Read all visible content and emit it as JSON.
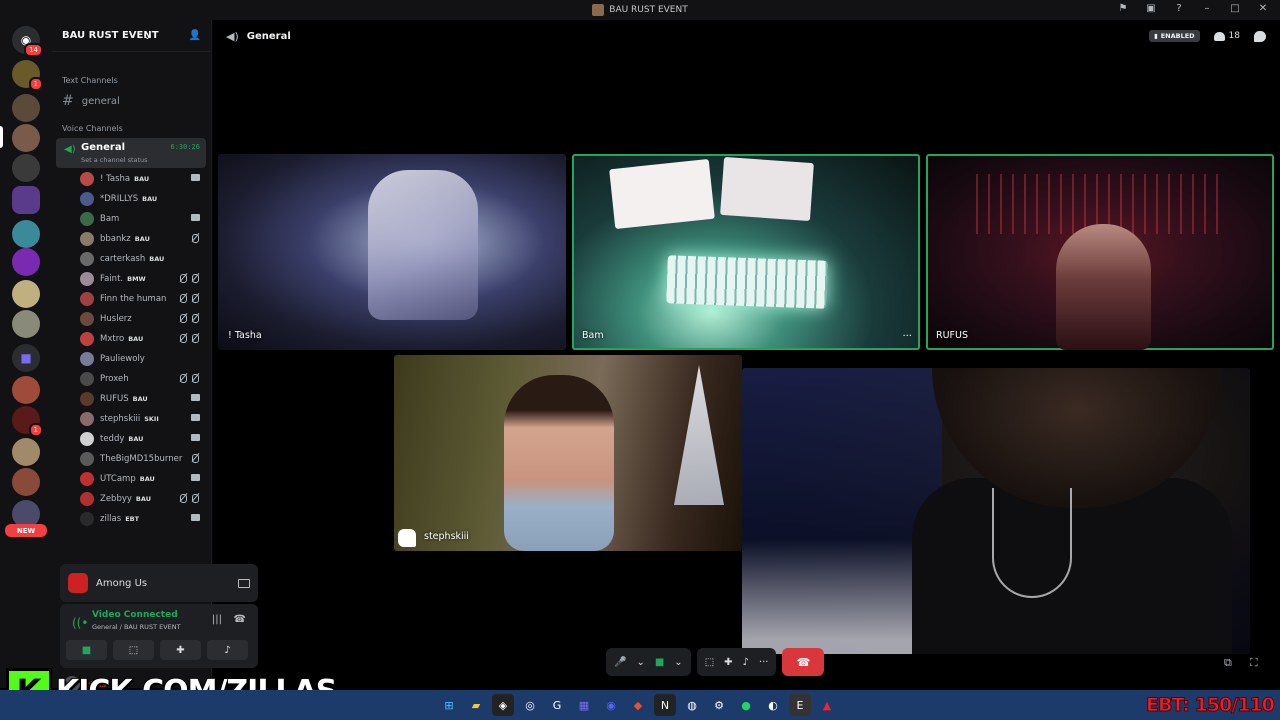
{
  "window": {
    "title": "BAU RUST EVENT"
  },
  "server": {
    "name": "BAU RUST EVENT"
  },
  "rail": {
    "home_badge": "14",
    "badge_1": "1",
    "badge_2": "1",
    "new_label": "NEW"
  },
  "categories": {
    "text": "Text Channels",
    "voice": "Voice Channels"
  },
  "text_channel": {
    "name": "general"
  },
  "voice_channel": {
    "name": "General",
    "status": "Set a channel status",
    "timer": "6:30:26"
  },
  "members": [
    {
      "name": "! Tasha",
      "tag": "BAU",
      "icons": [
        "cam"
      ],
      "color": "#b94a48"
    },
    {
      "name": "*DRILLYS",
      "tag": "BAU",
      "icons": [],
      "color": "#4a5a8a"
    },
    {
      "name": "Bam",
      "tag": "",
      "icons": [
        "cam"
      ],
      "color": "#3a6a4a"
    },
    {
      "name": "bbankz",
      "tag": "BAU",
      "icons": [
        "muted"
      ],
      "color": "#8a7a6a"
    },
    {
      "name": "carterkash",
      "tag": "BAU",
      "icons": [],
      "color": "#6a6a6a"
    },
    {
      "name": "Faint.",
      "tag": "BMW",
      "icons": [
        "muted",
        "muted"
      ],
      "color": "#9a8a9a"
    },
    {
      "name": "Finn the human",
      "tag": "",
      "icons": [
        "muted",
        "muted"
      ],
      "color": "#a04040"
    },
    {
      "name": "Huslerz",
      "tag": "",
      "icons": [
        "muted",
        "muted"
      ],
      "color": "#6a4a3a"
    },
    {
      "name": "Mxtro",
      "tag": "BAU",
      "icons": [
        "muted",
        "muted"
      ],
      "color": "#c04040"
    },
    {
      "name": "Pauliewoly",
      "tag": "",
      "icons": [],
      "color": "#7a7a9a"
    },
    {
      "name": "Proxeh",
      "tag": "",
      "icons": [
        "muted",
        "muted"
      ],
      "color": "#4a4a4a"
    },
    {
      "name": "RUFUS",
      "tag": "BAU",
      "icons": [
        "cam"
      ],
      "color": "#5a3a2a"
    },
    {
      "name": "stephskiii",
      "tag": "SKII",
      "icons": [
        "cam"
      ],
      "color": "#8a6a6a"
    },
    {
      "name": "teddy",
      "tag": "BAU",
      "icons": [
        "cam"
      ],
      "color": "#d0d0d0"
    },
    {
      "name": "TheBigMD15burner",
      "tag": "",
      "icons": [
        "muted"
      ],
      "color": "#5a5a5a"
    },
    {
      "name": "UTCamp",
      "tag": "BAU",
      "icons": [
        "cam"
      ],
      "color": "#c03030"
    },
    {
      "name": "Zebbyy",
      "tag": "BAU",
      "icons": [
        "muted",
        "muted"
      ],
      "color": "#b03030"
    },
    {
      "name": "zillas",
      "tag": "EBT",
      "icons": [
        "cam"
      ],
      "color": "#2a2a2a"
    }
  ],
  "activity": {
    "name": "Among Us"
  },
  "connection": {
    "title": "Video Connected",
    "subtitle": "General / BAU RUST EVENT"
  },
  "user": {
    "name": "zillas"
  },
  "header": {
    "channel": "General",
    "enabled": "ENABLED",
    "people_count": "18"
  },
  "tiles": [
    {
      "name": "! Tasha"
    },
    {
      "name": "Bam"
    },
    {
      "name": "RUFUS"
    },
    {
      "name": "stephskiii"
    }
  ],
  "overlay": {
    "kick_url": "KICK.COM/ZILLAS",
    "kick_k": "K",
    "ebt": "EBT: 150/110"
  },
  "colors": {
    "accent_green": "#23a55a",
    "danger": "#da373c",
    "kick_green": "#53fc18"
  }
}
